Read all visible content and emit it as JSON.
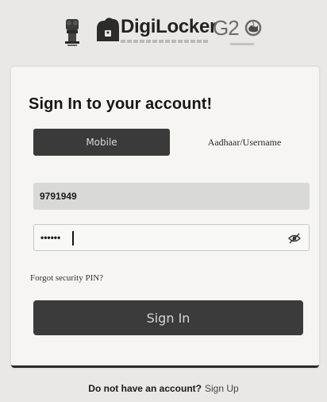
{
  "header": {
    "brand": "DigiLocker",
    "g20": "G2"
  },
  "login": {
    "title": "Sign In to your account!",
    "tabs": [
      {
        "label": "Mobile",
        "selected": true
      },
      {
        "label": "Aadhaar/Username",
        "selected": false
      }
    ],
    "mobile_value": "9791949",
    "pin_value": "••••••",
    "forgot_link": "Forgot security PIN?",
    "signin_label": "Sign In"
  },
  "footer": {
    "question": "Do not have an account?",
    "signup_link": "Sign Up"
  },
  "colors": {
    "primary_button": "#3b3b3b",
    "card_bg": "#f6f5f2"
  },
  "icons": {
    "pin_toggle": "eye-slash-icon"
  }
}
